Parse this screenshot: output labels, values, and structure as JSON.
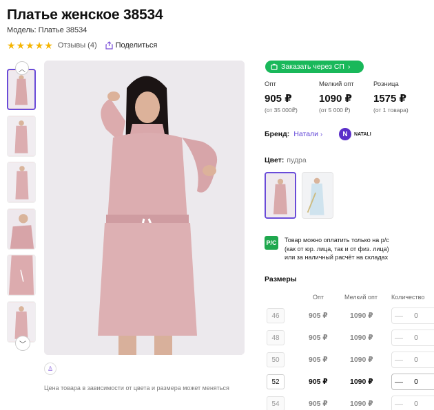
{
  "product": {
    "title": "Платье женское 38534",
    "model": "Модель: Платье 38534",
    "rating_stars": 5,
    "reviews": "Отзывы (4)",
    "share": "Поделиться"
  },
  "gallery": {
    "price_note": "Цена товара в зависимости от цвета и размера может меняться",
    "icons": {
      "up": "chevron-up-icon",
      "down": "chevron-down-icon",
      "ar": "hanger-icon"
    }
  },
  "order": {
    "sp_button": "Заказать через СП"
  },
  "prices": [
    {
      "label": "Опт",
      "value": "905 ₽",
      "sub": "(от 35 000₽)"
    },
    {
      "label": "Мелкий опт",
      "value": "1090 ₽",
      "sub": "(от 5 000 ₽)"
    },
    {
      "label": "Розница",
      "value": "1575 ₽",
      "sub": "(от 1 товара)"
    }
  ],
  "brand": {
    "label": "Бренд:",
    "name": "Натали",
    "logo_letter": "N",
    "logo_text": "NATALI"
  },
  "color": {
    "label": "Цвет:",
    "value": "пудра"
  },
  "payment": {
    "icon_text": "Р/С",
    "lines": [
      "Товар можно оплатить только на р/с",
      "(как от юр. лица, так и от физ. лица)",
      "или за наличный расчёт на складах"
    ]
  },
  "sizes": {
    "title": "Размеры",
    "headers": {
      "opt": "Опт",
      "small_opt": "Мелкий опт",
      "qty": "Количество"
    },
    "rows": [
      {
        "size": "46",
        "opt": "905 ₽",
        "small_opt": "1090 ₽",
        "qty": "0",
        "minus": "—"
      },
      {
        "size": "48",
        "opt": "905 ₽",
        "small_opt": "1090 ₽",
        "qty": "0",
        "minus": "—"
      },
      {
        "size": "50",
        "opt": "905 ₽",
        "small_opt": "1090 ₽",
        "qty": "0",
        "minus": "—"
      },
      {
        "size": "52",
        "opt": "905 ₽",
        "small_opt": "1090 ₽",
        "qty": "0",
        "minus": "—"
      },
      {
        "size": "54",
        "opt": "905 ₽",
        "small_opt": "1090 ₽",
        "qty": "0",
        "minus": "—"
      }
    ]
  },
  "colors": {
    "accent": "#6a4bd8",
    "green": "#19b85a",
    "star": "#f5b400"
  }
}
